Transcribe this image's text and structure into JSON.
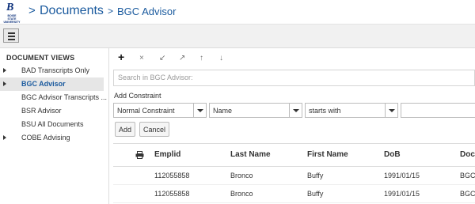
{
  "header": {
    "logo_letter": "B",
    "logo_text": "BOISE STATE UNIVERSITY",
    "crumb_separator": ">",
    "crumb1": "Documents",
    "crumb2": "BGC Advisor"
  },
  "toolbar": {
    "menu_icon": "hamburger-icon"
  },
  "sidebar": {
    "title": "DOCUMENT VIEWS",
    "items": [
      {
        "label": "BAD Transcripts Only",
        "expandable": true,
        "selected": false
      },
      {
        "label": "BGC Advisor",
        "expandable": true,
        "selected": true
      },
      {
        "label": "BGC Advisor Transcripts ...",
        "expandable": false,
        "selected": false
      },
      {
        "label": "BSR Advisor",
        "expandable": false,
        "selected": false
      },
      {
        "label": "BSU All Documents",
        "expandable": false,
        "selected": false
      },
      {
        "label": "COBE Advising",
        "expandable": true,
        "selected": false
      }
    ]
  },
  "actions": {
    "add": "+",
    "remove": "×",
    "collapse": "↙",
    "expand": "↗",
    "up": "↑",
    "down": "↓"
  },
  "search": {
    "placeholder": "Search in BGC Advisor:"
  },
  "constraint": {
    "label": "Add Constraint",
    "type_value": "Normal Constraint",
    "field_value": "Name",
    "operator_value": "starts with",
    "value": "",
    "add_button": "Add",
    "cancel_button": "Cancel"
  },
  "grid": {
    "columns": [
      "Emplid",
      "Last Name",
      "First Name",
      "DoB",
      "Doc"
    ],
    "rows": [
      {
        "emplid": "112055858",
        "last": "Bronco",
        "first": "Buffy",
        "dob": "1991/01/15",
        "doc": "BGC"
      },
      {
        "emplid": "112055858",
        "last": "Bronco",
        "first": "Buffy",
        "dob": "1991/01/15",
        "doc": "BGC"
      }
    ]
  },
  "colors": {
    "accent": "#1a5a9e",
    "selected_bg": "#e6e6e6"
  }
}
